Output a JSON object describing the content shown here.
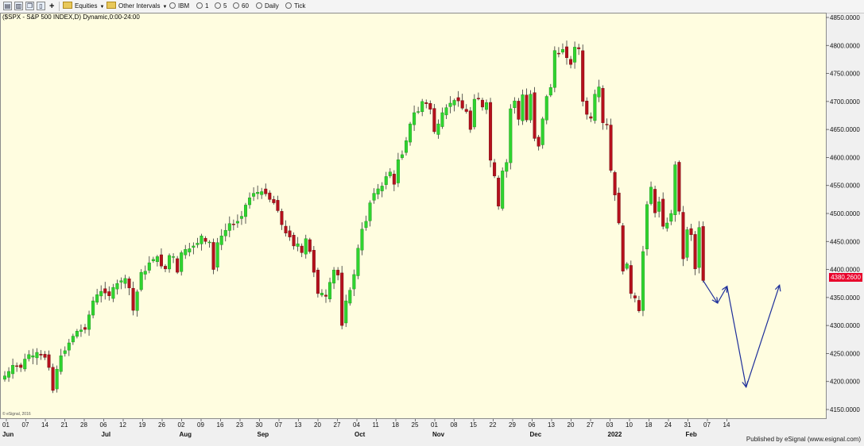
{
  "toolbar": {
    "equities_label": "Equities",
    "other_intervals_label": "Other Intervals",
    "buttons": [
      "IBM",
      "1",
      "5",
      "60",
      "Daily",
      "Tick"
    ]
  },
  "title": "($SPX - S&P 500 INDEX,D) Dynamic,0:00-24:00",
  "watermark": "© eSignal, 2016",
  "credit": "Published by eSignal (www.esignal.com)",
  "last_price_label": "4380.2600",
  "colors": {
    "background": "#fffde0",
    "up": "#2fd42f",
    "down": "#b5101c",
    "wick": "#333333",
    "projection": "#1e2f9a",
    "price_label_bg": "#e8002a"
  },
  "chart_data": {
    "type": "candlestick",
    "title": "($SPX - S&P 500 INDEX,D) Dynamic,0:00-24:00",
    "ylim": [
      4130,
      4860
    ],
    "y_ticks": [
      4150,
      4200,
      4250,
      4300,
      4350,
      4400,
      4450,
      4500,
      4550,
      4600,
      4650,
      4700,
      4750,
      4800,
      4850
    ],
    "y_tick_labels": [
      "4150.0000",
      "4200.0000",
      "4250.0000",
      "4300.0000",
      "4350.0000",
      "4400.0000",
      "4450.0000",
      "4500.0000",
      "4550.0000",
      "4600.0000",
      "4650.0000",
      "4700.0000",
      "4750.0000",
      "4800.0000",
      "4850.0000"
    ],
    "x_labels": [
      "01",
      "07",
      "14",
      "21",
      "28",
      "06",
      "12",
      "19",
      "26",
      "02",
      "09",
      "16",
      "23",
      "30",
      "07",
      "13",
      "20",
      "27",
      "04",
      "11",
      "18",
      "25",
      "01",
      "08",
      "15",
      "22",
      "29",
      "06",
      "13",
      "20",
      "27",
      "03",
      "10",
      "18",
      "24",
      "31",
      "07",
      "14"
    ],
    "month_labels": [
      {
        "text": "Jun",
        "at": 0
      },
      {
        "text": "Jul",
        "at": 5
      },
      {
        "text": "Aug",
        "at": 9
      },
      {
        "text": "Sep",
        "at": 13
      },
      {
        "text": "Oct",
        "at": 18
      },
      {
        "text": "Nov",
        "at": 22
      },
      {
        "text": "Dec",
        "at": 27
      },
      {
        "text": "2022",
        "at": 31
      },
      {
        "text": "Feb",
        "at": 35
      }
    ],
    "grid": false,
    "last_price": 4380.26,
    "close": [
      4210,
      4218,
      4229,
      4228,
      4225,
      4240,
      4248,
      4246,
      4252,
      4247,
      4243,
      4225,
      4184,
      4222,
      4246,
      4255,
      4269,
      4281,
      4290,
      4292,
      4293,
      4319,
      4344,
      4355,
      4361,
      4358,
      4353,
      4368,
      4375,
      4380,
      4384,
      4367,
      4327,
      4360,
      4395,
      4397,
      4412,
      4418,
      4423,
      4406,
      4401,
      4425,
      4423,
      4395,
      4430,
      4436,
      4437,
      4442,
      4447,
      4460,
      4450,
      4449,
      4400,
      4448,
      4460,
      4470,
      4482,
      4480,
      4486,
      4495,
      4515,
      4528,
      4536,
      4538,
      4539,
      4535,
      4525,
      4519,
      4505,
      4480,
      4465,
      4458,
      4442,
      4446,
      4430,
      4455,
      4432,
      4395,
      4357,
      4358,
      4352,
      4377,
      4399,
      4390,
      4300,
      4344,
      4363,
      4391,
      4438,
      4472,
      4486,
      4519,
      4536,
      4544,
      4549,
      4566,
      4574,
      4552,
      4596,
      4605,
      4630,
      4660,
      4680,
      4682,
      4700,
      4696,
      4686,
      4646,
      4660,
      4680,
      4689,
      4697,
      4702,
      4701,
      4688,
      4682,
      4650,
      4704,
      4705,
      4690,
      4698,
      4595,
      4567,
      4513,
      4576,
      4591,
      4687,
      4701,
      4668,
      4712,
      4667,
      4713,
      4634,
      4620,
      4669,
      4709,
      4725,
      4791,
      4786,
      4793,
      4778,
      4766,
      4797,
      4794,
      4700,
      4677,
      4670,
      4713,
      4726,
      4662,
      4659,
      4577,
      4533,
      4483,
      4397,
      4410,
      4357,
      4349,
      4326,
      4432,
      4516,
      4547,
      4501,
      4521,
      4477,
      4483,
      4500,
      4587,
      4504,
      4419,
      4471,
      4462,
      4401,
      4475,
      4380.26
    ],
    "projection": {
      "description": "Anticipated path drawn with arrows",
      "points": [
        {
          "step": 0,
          "value": 4380
        },
        {
          "step": 3,
          "value": 4340
        },
        {
          "step": 5,
          "value": 4370
        },
        {
          "step": 9,
          "value": 4190
        },
        {
          "step": 16,
          "value": 4372
        }
      ]
    }
  }
}
